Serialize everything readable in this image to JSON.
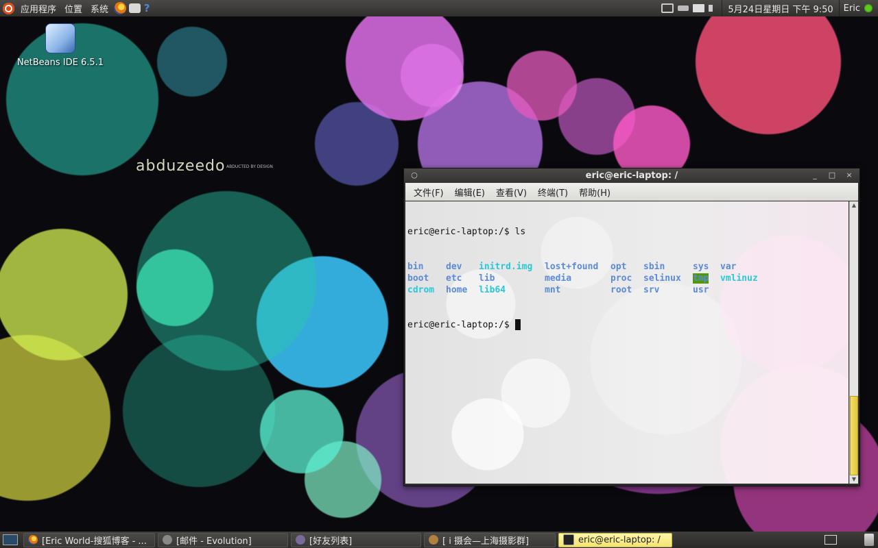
{
  "top_panel": {
    "applications": "应用程序",
    "places": "位置",
    "system": "系统",
    "clock": "5月24日星期日 下午 9:50",
    "user": "Eric"
  },
  "desktop": {
    "icon_label": "NetBeans IDE 6.5.1",
    "brand": "abduzeedo",
    "brand_sub": "ABDUCTED BY DESIGN"
  },
  "terminal": {
    "title": "eric@eric-laptop: /",
    "menu": [
      "文件(F)",
      "编辑(E)",
      "查看(V)",
      "终端(T)",
      "帮助(H)"
    ],
    "prompt1": "eric@eric-laptop:/$ ls",
    "rows": [
      [
        "bin",
        "dev",
        "initrd.img",
        "lost+found",
        "opt",
        "sbin",
        "sys",
        "var"
      ],
      [
        "boot",
        "etc",
        "lib",
        "media",
        "proc",
        "selinux",
        "tmp",
        "vmlinuz"
      ],
      [
        "cdrom",
        "home",
        "lib64",
        "mnt",
        "root",
        "srv",
        "usr",
        ""
      ]
    ],
    "prompt2": "eric@eric-laptop:/$ ",
    "scroll_position": 1.0,
    "colors": {
      "dir": "#5b8ad6",
      "link": "#28c8d8",
      "tmp_bg": "#4e9a06"
    }
  },
  "taskbar": {
    "tasks": [
      {
        "label": "[Eric World-搜狐博客 - ...",
        "icon": "firefox-icon"
      },
      {
        "label": "[邮件 - Evolution]",
        "icon": "evolution-icon"
      },
      {
        "label": "[好友列表]",
        "icon": "qq-icon"
      },
      {
        "label": "[ i 摄会—上海摄影群]",
        "icon": "qq-group-icon"
      },
      {
        "label": "eric@eric-laptop: /",
        "icon": "terminal-icon"
      }
    ]
  }
}
